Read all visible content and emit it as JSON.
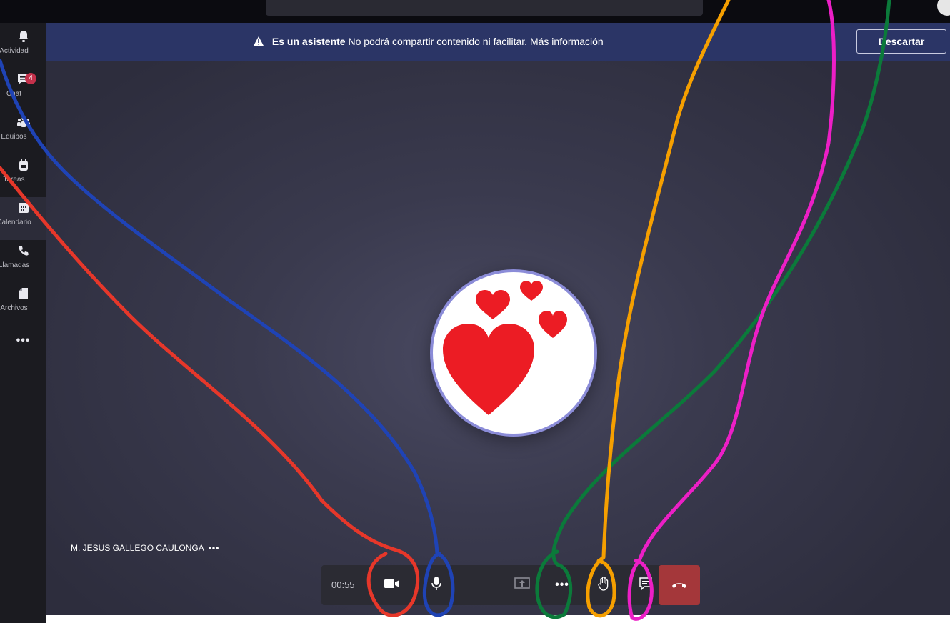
{
  "rail": {
    "items": [
      {
        "label": "Actividad",
        "icon": "bell-icon"
      },
      {
        "label": "Chat",
        "icon": "chat-icon",
        "badge": "4"
      },
      {
        "label": "Equipos",
        "icon": "teams-icon"
      },
      {
        "label": "Tareas",
        "icon": "backpack-icon"
      },
      {
        "label": "Calendario",
        "icon": "calendar-icon"
      },
      {
        "label": "Llamadas",
        "icon": "phone-icon"
      },
      {
        "label": "Archivos",
        "icon": "file-icon"
      }
    ],
    "more": "•••"
  },
  "banner": {
    "bold": "Es un asistente",
    "text": " No podrá compartir contenido ni facilitar. ",
    "link": "Más información",
    "dismiss": "Descartar"
  },
  "participant": {
    "name": "M. JESUS GALLEGO CAULONGA",
    "more": "•••"
  },
  "controls": {
    "timer": "00:55"
  },
  "colors": {
    "banner": "#2b3566",
    "hangup": "#a4373a",
    "ring": "#8b8cd8",
    "annotations": [
      "#e6372a",
      "#1f43b5",
      "#0b7a3a",
      "#f59f00",
      "#ec1fc6"
    ]
  }
}
